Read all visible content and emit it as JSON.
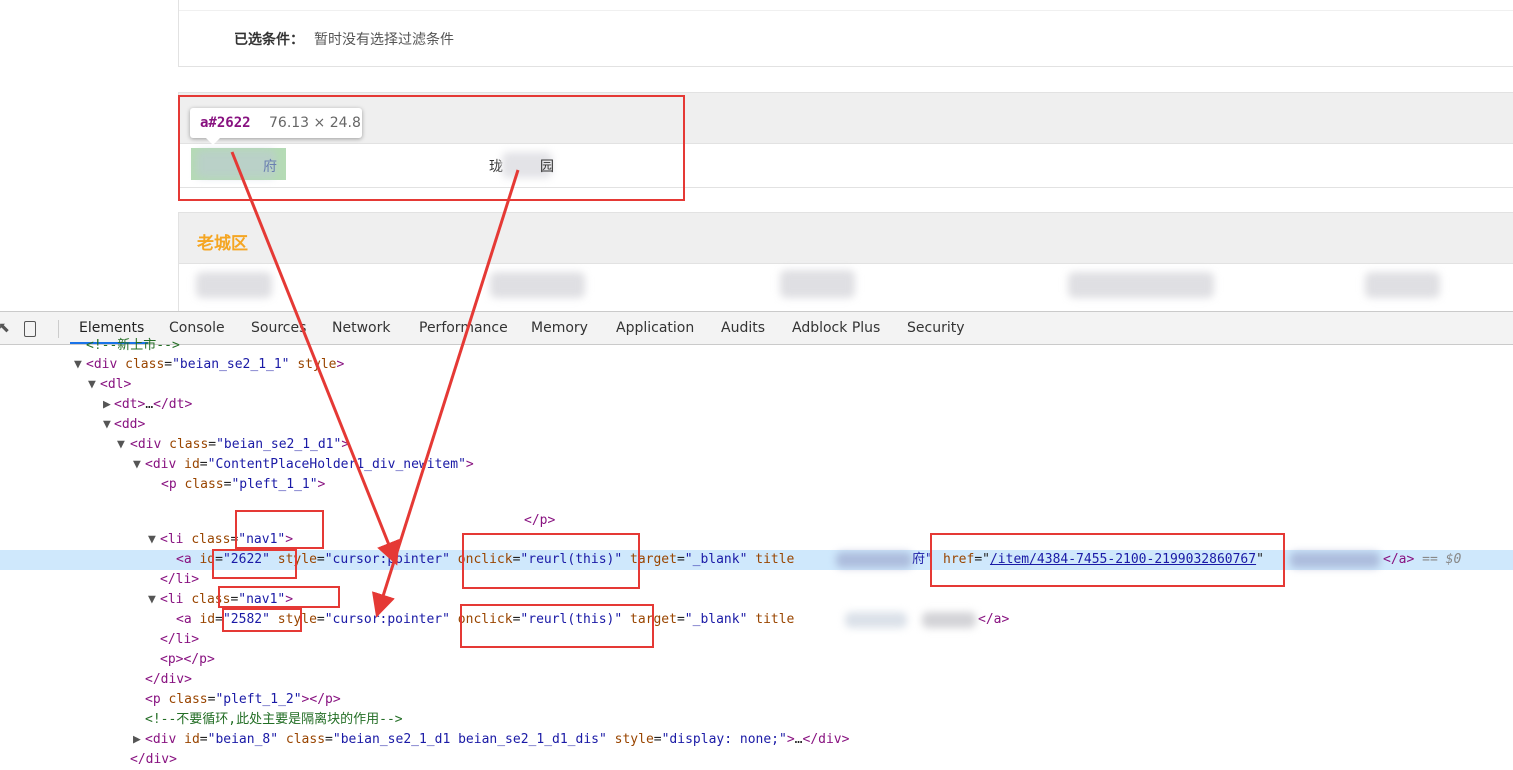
{
  "filter": {
    "label": "已选条件：",
    "value": "暂时没有选择过滤条件"
  },
  "section1": {
    "item1_partial": "府",
    "item2_partial_a": "珑",
    "item2_partial_b": "园"
  },
  "section2": {
    "title": "老城区"
  },
  "tooltip": {
    "element_id": "a#2622",
    "size": "76.13 × 24.8"
  },
  "devtools": {
    "tabs": [
      "Elements",
      "Console",
      "Sources",
      "Network",
      "Performance",
      "Memory",
      "Application",
      "Audits",
      "Adblock Plus",
      "Security"
    ],
    "active_tab": "Elements",
    "code": {
      "l0": "<!--新上市-->",
      "l1_tag": "div",
      "l1_attr": "class",
      "l1_val": "\"beian_se2_1_1\"",
      "l1_attr2": "style",
      "l2": "dl",
      "l3": "dt",
      "l4": "dd",
      "l5_tag": "div",
      "l5_attr": "class",
      "l5_val": "\"beian_se2_1_d1\"",
      "l6_tag": "div",
      "l6_attr": "id",
      "l6_val": "\"ContentPlaceHolder1_div_newitem\"",
      "l7_tag": "p",
      "l7_attr": "class",
      "l7_val": "\"pleft_1_1\"",
      "l8": "</p>",
      "li_tag": "li",
      "li_attr": "class",
      "li_val": "\"nav1\"",
      "a_tag": "a",
      "id_attr": "id",
      "a1_id": "\"2622\"",
      "style_attr": "style",
      "style_val": "\"cursor:pointer\"",
      "onclick_attr": "onclick",
      "onclick_val": "\"reurl(this)\"",
      "target_attr": "target",
      "target_val": "\"_blank\"",
      "title_attr": "title",
      "a1_title_partial": "府\"",
      "href_attr": "href",
      "href_val": "/item/4384-7455-2100-2199032860767",
      "a_close": "</a>",
      "eq_marker": "== $0",
      "li_close": "</li>",
      "a2_id": "\"2582\"",
      "p_empty": "<p></p>",
      "div_close": "</div>",
      "p2_attr_val": "\"pleft_1_2\"",
      "comment2": "<!--不要循环,此处主要是隔离块的作用-->",
      "div8_id": "\"beian_8\"",
      "div8_class": "\"beian_se2_1_d1 beian_se2_1_d1_dis\"",
      "div8_style": "\"display: none;\""
    }
  }
}
